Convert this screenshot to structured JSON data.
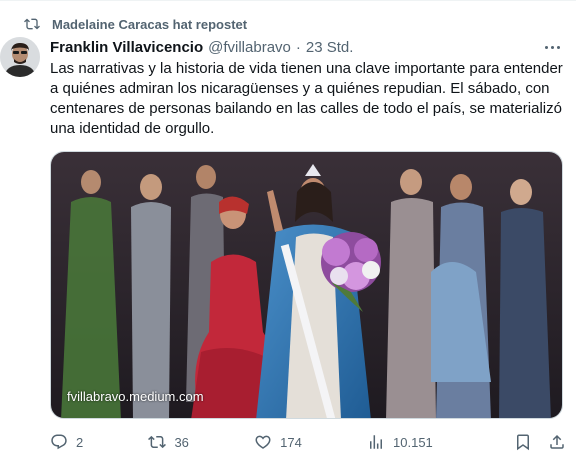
{
  "repost": {
    "text": "Madelaine Caracas hat repostet"
  },
  "author": {
    "name": "Franklin Villavicencio",
    "handle": "@fvillabravo",
    "separator": "·",
    "time": "23 Std."
  },
  "tweet": {
    "text": "Las narrativas y la historia de vida tienen una clave importante para entender a quiénes admiran los nicaragüenses y a quiénes repudian. El sábado, con centenares de personas bailando en las calles de todo el país, se materializó una identidad de orgullo."
  },
  "media": {
    "watermark": "fvillabravo.medium.com"
  },
  "actions": {
    "replies": "2",
    "reposts": "36",
    "likes": "174",
    "views": "10.151"
  },
  "icons": [
    "repost-icon",
    "avatar",
    "more-icon",
    "reply-icon",
    "like-icon",
    "views-icon",
    "bookmark-icon",
    "share-icon"
  ],
  "colors": {
    "text": "#0f1419",
    "secondary": "#536471",
    "border": "#cfd9de"
  }
}
